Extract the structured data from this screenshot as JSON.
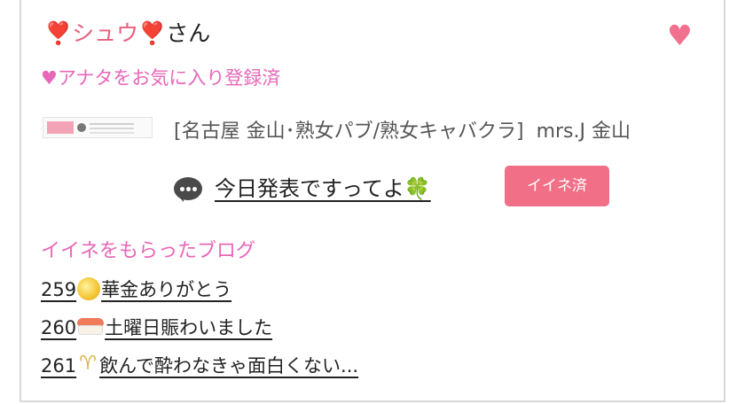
{
  "user": {
    "name": "❣️シュウ❣️",
    "honorific": "さん"
  },
  "favorite_status": "♥アナタをお気に入り登録済",
  "shop": {
    "category": "[名古屋 金山･熟女パブ/熟女キャバクラ]",
    "name": "mrs.J 金山"
  },
  "blog": {
    "title": "今日発表ですってよ🍀",
    "iine_label": "イイネ済"
  },
  "liked_section": {
    "title": "イイネをもらったブログ",
    "items": [
      {
        "num": "259",
        "icon": "moon-icon",
        "text": "華金ありがとう"
      },
      {
        "num": "260",
        "icon": "sushi-icon",
        "text": "土曜日賑わいました"
      },
      {
        "num": "261",
        "icon": "champagne-glasses-icon",
        "text": "飲んで酔わなきゃ面白くない..."
      }
    ]
  },
  "colors": {
    "accent_pink": "#e767b8",
    "button_pink": "#f17087",
    "name_pink": "#e8607f",
    "heart": "#f0708e"
  }
}
